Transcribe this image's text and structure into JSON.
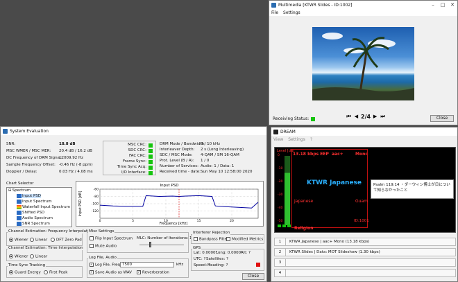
{
  "multimedia": {
    "title": "Multimedia [KTWR Slides - ID:1002]",
    "menu": [
      "File",
      "Settings"
    ],
    "receiving_status_label": "Receiving Status:",
    "slide_counter": "2/4",
    "close_label": "Close"
  },
  "system_eval": {
    "title": "System Evaluation",
    "stats": [
      {
        "label": "SNR:",
        "value": "18.8 dB"
      },
      {
        "label": "MSC WMER / MSC MER:",
        "value": "20.4 dB / 16.2 dB"
      },
      {
        "label": "DC Frequency of DRM Signal:",
        "value": "12009.92 Hz"
      },
      {
        "label": "Sample Frequency Offset:",
        "value": "-0.46 Hz (-8 ppm)"
      },
      {
        "label": "Doppler / Delay:",
        "value": "0.03 Hz / 4.08 ms"
      }
    ],
    "crc": [
      {
        "label": "MSC CRC:"
      },
      {
        "label": "SDC CRC:"
      },
      {
        "label": "FAC CRC:"
      },
      {
        "label": "Frame Sync:"
      },
      {
        "label": "Time Sync Acq:"
      },
      {
        "label": "I/O Interface:"
      }
    ],
    "params": [
      {
        "label": "DRM Mode / Bandwidth:",
        "value": "B / 10 kHz"
      },
      {
        "label": "Interleaver Depth:",
        "value": "2 s (Long Interleaving)"
      },
      {
        "label": "SDC / MSC Mode:",
        "value": "4-QAM / SM 16-QAM"
      },
      {
        "label": "Prot. Level (B / A):",
        "value": "1 / 0"
      },
      {
        "label": "Number of Services:",
        "value": "Audio: 1 / Data: 1"
      },
      {
        "label": "Received time - date:",
        "value": "Sun May 10 12:58:00 2020"
      }
    ],
    "chart_selector": {
      "title": "Chart Selector",
      "items": [
        "Spectrum",
        "Input PSD",
        "Input Spectrum",
        "Waterfall Input Spectrum",
        "Shifted PSD",
        "Audio Spectrum",
        "SNR Spectrum"
      ]
    },
    "freq_interp": {
      "title": "Channel Estimation: Frequency Interpolation",
      "options": [
        "Wiener",
        "Linear",
        "DFT Zero Pad"
      ]
    },
    "time_interp": {
      "title": "Channel Estimation: Time Interpolation",
      "options": [
        "Wiener",
        "Linear"
      ]
    },
    "time_sync": {
      "title": "Time Sync Tracking",
      "options": [
        "Guard Energy",
        "First Peak"
      ]
    },
    "misc": {
      "title": "Misc Settings",
      "flip": "Flip Input Spectrum",
      "mute": "Mute Audio",
      "mlc": "MLC: Number of Iterations: 1"
    },
    "interferer": {
      "title": "Interferer Rejection",
      "bandpass": "Bandpass Filter",
      "modified": "Modified Metrics"
    },
    "log": {
      "title": "Log File, Audio",
      "log_file": "Log File, Freq",
      "freq_value": "7500",
      "unit": "kHz",
      "save_wav": "Save Audio as WAV",
      "reverb": "Reverberation"
    },
    "gps": {
      "title": "GPS",
      "lat": "Lat: 0.0000°",
      "long": "Long: 0.0000°",
      "alt": "Alt: ?",
      "utc": "UTC: ?",
      "sats": "Satellites: ?",
      "speed": "Speed: ?",
      "heading": "Heading: ?"
    },
    "close_label": "Close"
  },
  "chart_data": {
    "type": "line",
    "title": "Input PSD",
    "xlabel": "Frequency [kHz]",
    "ylabel": "Input PSD [dB]",
    "xlim": [
      0,
      24
    ],
    "ylim": [
      -140,
      -60
    ],
    "xticks": [
      0,
      5,
      10,
      15,
      20
    ],
    "yticks": [
      -60,
      -80,
      -100,
      -120
    ],
    "marker_x": 12,
    "series": [
      {
        "color": "#0000a0",
        "x": [
          0,
          2,
          4,
          6.5,
          7,
          9,
          11,
          12,
          13,
          15,
          17,
          17.5,
          19,
          21,
          23,
          24
        ],
        "y": [
          -104,
          -106,
          -107,
          -107,
          -78,
          -80,
          -79,
          -80,
          -79,
          -78,
          -80,
          -106,
          -108,
          -110,
          -112,
          -96
        ]
      }
    ]
  },
  "dream": {
    "title": "DREAM",
    "menu": [
      "View",
      "Settings",
      "?"
    ],
    "level_label": "Level [dB]",
    "bitrate": "13.18 kbps EEP",
    "codec": "aac+",
    "mode": "Mono",
    "station": "KTWR Japanese",
    "language": "Japanese",
    "country": "Guam",
    "id": "ID:1001",
    "text_message": "Psalm 119:14 ・ダーウィン博士が日について知らなかったこと",
    "program_type": "Religion",
    "level_scale": [
      "0",
      "-10",
      "-20",
      "-30",
      "-40",
      "-50"
    ],
    "services": [
      {
        "num": "1",
        "text": "KTWR Japanese  |  aac+ Mono (13.18 kbps)"
      },
      {
        "num": "2",
        "text": "KTWR Slides  |  Data: MOT Slideshow (1.30 kbps)"
      },
      {
        "num": "3",
        "text": ""
      },
      {
        "num": "4",
        "text": ""
      }
    ]
  }
}
